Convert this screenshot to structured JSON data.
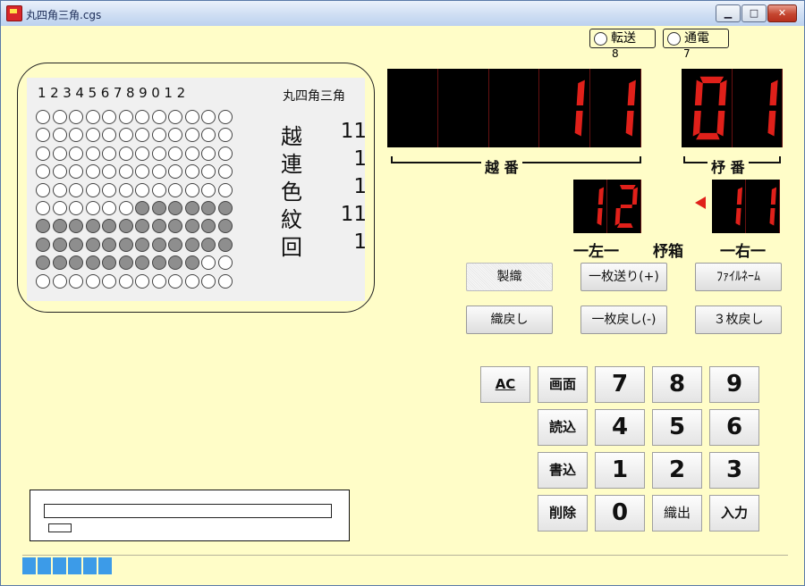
{
  "window": {
    "title": "丸四角三角.cgs",
    "minimize": "▁",
    "maximize": "□",
    "close": "✕"
  },
  "indicators": [
    {
      "label": "転送",
      "count": "8"
    },
    {
      "label": "通電",
      "count": "7"
    }
  ],
  "pattern": {
    "column_numbers": "123456789012",
    "title": "丸四角三角",
    "rows": [
      [
        0,
        0,
        0,
        0,
        0,
        0,
        0,
        0,
        0,
        0,
        0,
        0
      ],
      [
        0,
        0,
        0,
        0,
        0,
        0,
        0,
        0,
        0,
        0,
        0,
        0
      ],
      [
        0,
        0,
        0,
        0,
        0,
        0,
        0,
        0,
        0,
        0,
        0,
        0
      ],
      [
        0,
        0,
        0,
        0,
        0,
        0,
        0,
        0,
        0,
        0,
        0,
        0
      ],
      [
        0,
        0,
        0,
        0,
        0,
        0,
        0,
        0,
        0,
        0,
        0,
        0
      ],
      [
        0,
        0,
        0,
        0,
        0,
        0,
        1,
        1,
        1,
        1,
        1,
        1
      ],
      [
        1,
        1,
        1,
        1,
        1,
        1,
        1,
        1,
        1,
        1,
        1,
        1
      ],
      [
        1,
        1,
        1,
        1,
        1,
        1,
        1,
        1,
        1,
        1,
        1,
        1
      ],
      [
        1,
        1,
        1,
        1,
        1,
        1,
        1,
        1,
        1,
        1,
        0,
        0
      ],
      [
        0,
        0,
        0,
        0,
        0,
        0,
        0,
        0,
        0,
        0,
        0,
        0
      ]
    ],
    "stats": [
      {
        "label": "越",
        "value": "11"
      },
      {
        "label": "連",
        "value": "1"
      },
      {
        "label": "色",
        "value": "1"
      },
      {
        "label": "紋",
        "value": "11"
      },
      {
        "label": "回",
        "value": "1"
      }
    ]
  },
  "displays": {
    "koshi_digits": [
      "",
      "",
      "",
      "1",
      "1"
    ],
    "koshi_label": "越 番",
    "hi_digits": [
      "0",
      "1"
    ],
    "hi_label": "杼 番",
    "left_digits": [
      "1",
      "2"
    ],
    "right_digits": [
      "1",
      "1"
    ],
    "left_label": "一左一",
    "center_label": "杼箱",
    "right_label": "一右一"
  },
  "buttons": {
    "weave": "製織",
    "next_one": "一枚送り(+)",
    "filename": "ﾌｧｲﾙﾈｰﾑ",
    "weave_back": "織戻し",
    "back_one": "一枚戻し(-)",
    "back_three": "３枚戻し"
  },
  "keypad": {
    "ac": "AC",
    "screen": "画面",
    "read": "読込",
    "write": "書込",
    "delete": "削除",
    "weave_out": "織出",
    "enter": "入力",
    "digits": [
      "7",
      "8",
      "9",
      "4",
      "5",
      "6",
      "1",
      "2",
      "3",
      "0"
    ]
  },
  "colors": {
    "background": "#fffdc8",
    "segment_on": "#e0201a",
    "progress": "#3c9be8"
  },
  "progress": {
    "blocks": 6
  }
}
